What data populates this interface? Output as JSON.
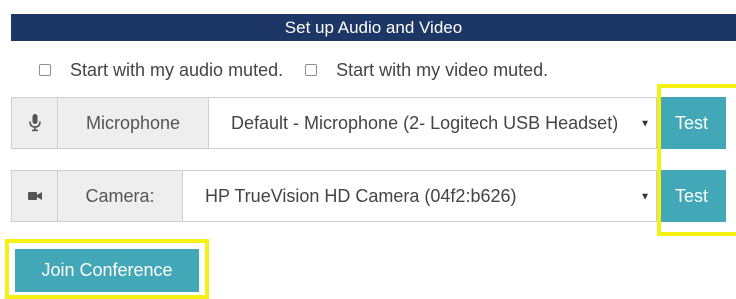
{
  "header": {
    "title": "Set up Audio and Video"
  },
  "options": {
    "audio_muted_label": "Start with my audio muted.",
    "video_muted_label": "Start with my video muted."
  },
  "microphone": {
    "icon": "microphone-icon",
    "label": "Microphone",
    "selected": "Default - Microphone (2- Logitech USB Headset)",
    "test_label": "Test"
  },
  "camera": {
    "icon": "camera-icon",
    "label": "Camera:",
    "selected": "HP TrueVision HD Camera (04f2:b626)",
    "test_label": "Test"
  },
  "join_label": "Join Conference",
  "colors": {
    "header": "#1c3765",
    "button": "#42a7b7",
    "highlight": "#f5f113"
  }
}
